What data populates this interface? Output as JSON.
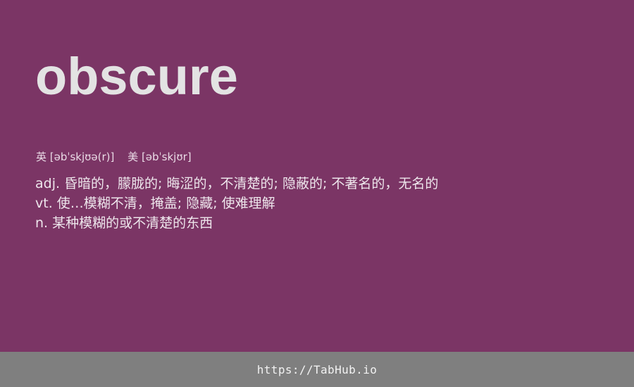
{
  "entry": {
    "word": "obscure",
    "phonetics": {
      "uk": "英 [əbˈskjʊə(r)]",
      "us": "美 [əbˈskjʊr]"
    },
    "definitions": [
      "adj. 昏暗的，朦胧的; 晦涩的，不清楚的; 隐蔽的; 不著名的，无名的",
      "vt. 使…模糊不清，掩盖; 隐藏; 使难理解",
      "n. 某种模糊的或不清楚的东西"
    ]
  },
  "footer": {
    "link_text": "https://TabHub.io"
  },
  "colors": {
    "background": "#7b3565",
    "footer_bar": "#7f7f7f",
    "text": "#e6e6e6"
  }
}
